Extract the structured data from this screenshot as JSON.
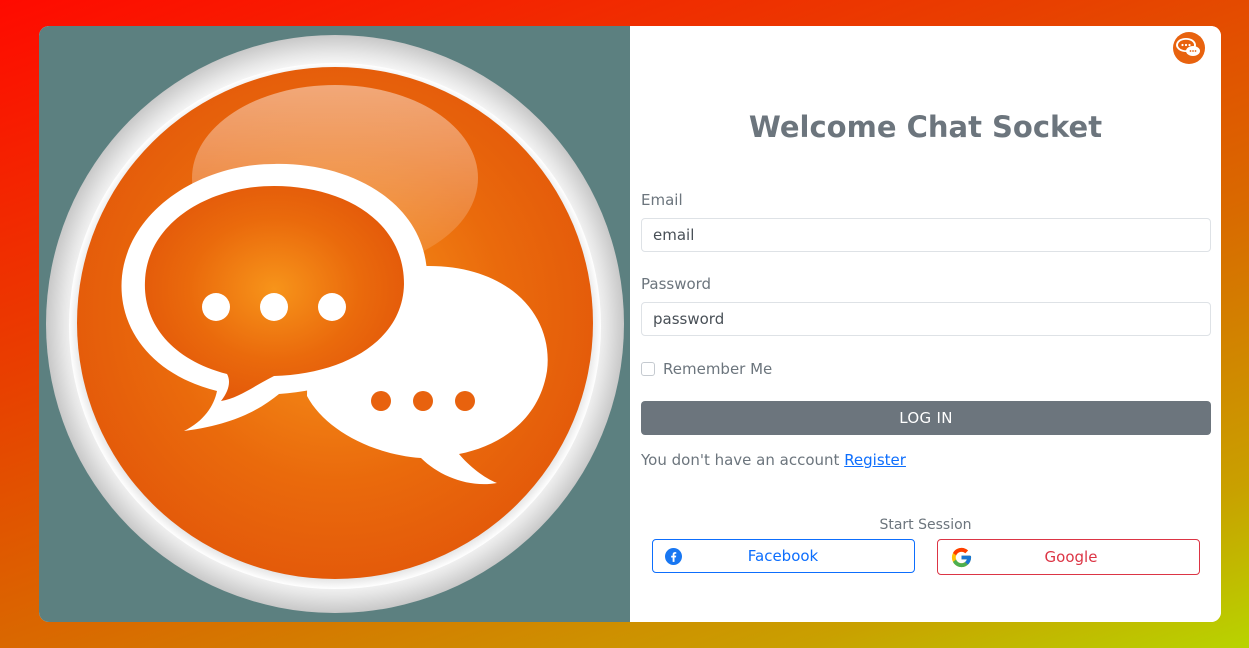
{
  "app": {
    "title": "Welcome Chat Socket"
  },
  "form": {
    "email_label": "Email",
    "email_value": "email",
    "password_label": "Password",
    "password_value": "password",
    "remember_label": "Remember Me",
    "remember_checked": false,
    "login_label": "LOG IN",
    "no_account_text": "You don't have an account",
    "register_label": "Register"
  },
  "social": {
    "heading": "Start Session",
    "facebook_label": "Facebook",
    "google_label": "Google"
  },
  "icons": {
    "hero": "chat-bubbles-icon",
    "corner": "chat-logo-icon",
    "facebook": "facebook-icon",
    "google": "google-icon"
  },
  "colors": {
    "brand_orange": "#e8620e",
    "panel_teal": "#5c8080",
    "title_gray": "#6c757d",
    "facebook_blue": "#0d6efd",
    "google_red": "#dc3545"
  }
}
